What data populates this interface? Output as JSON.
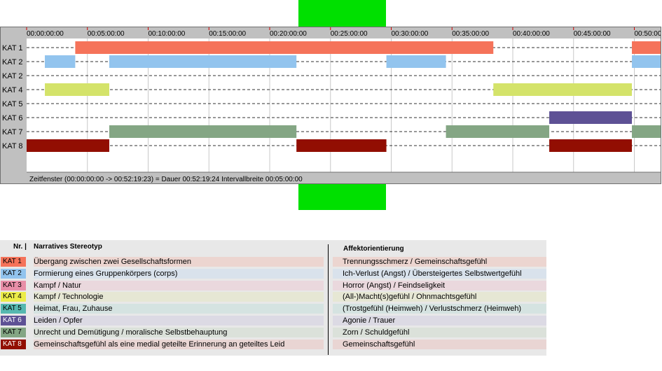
{
  "timeline": {
    "row_labels": [
      "KAT 1",
      "KAT 2",
      "KAT 2",
      "KAT 4",
      "KAT 5",
      "KAT 6",
      "KAT 7",
      "KAT 8"
    ],
    "tick_labels": [
      "00:00:00:00",
      "00:05:00:00",
      "00:10:00:00",
      "00:15:00:00",
      "00:20:00:00",
      "00:25:00:00",
      "00:30:00:00",
      "00:35:00:00",
      "00:40:00:00",
      "00:45:00:00",
      "00:50:00"
    ],
    "status_text": "Zeitfenster (00:00:00:00 -> 00:52:19:23) = Dauer 00:52:19:24    Intervallbreite 00:05:00:00",
    "segments": [
      {
        "row": 0,
        "start_min": 4.0,
        "end_min": 38.4,
        "color": "#f5735a"
      },
      {
        "row": 0,
        "start_min": 49.8,
        "end_min": 52.33,
        "color": "#f5735a"
      },
      {
        "row": 1,
        "start_min": 1.5,
        "end_min": 4.0,
        "color": "#92c4ee"
      },
      {
        "row": 1,
        "start_min": 6.8,
        "end_min": 22.2,
        "color": "#92c4ee"
      },
      {
        "row": 1,
        "start_min": 29.6,
        "end_min": 34.5,
        "color": "#92c4ee"
      },
      {
        "row": 1,
        "start_min": 49.8,
        "end_min": 52.33,
        "color": "#92c4ee"
      },
      {
        "row": 3,
        "start_min": 1.5,
        "end_min": 6.8,
        "color": "#d4e36a"
      },
      {
        "row": 3,
        "start_min": 38.4,
        "end_min": 49.8,
        "color": "#d4e36a"
      },
      {
        "row": 5,
        "start_min": 43.0,
        "end_min": 49.8,
        "color": "#5e5195"
      },
      {
        "row": 6,
        "start_min": 6.8,
        "end_min": 22.2,
        "color": "#84a684"
      },
      {
        "row": 6,
        "start_min": 34.5,
        "end_min": 43.0,
        "color": "#84a684"
      },
      {
        "row": 6,
        "start_min": 49.8,
        "end_min": 52.33,
        "color": "#84a684"
      },
      {
        "row": 7,
        "start_min": 0,
        "end_min": 6.8,
        "color": "#920e02"
      },
      {
        "row": 7,
        "start_min": 22.2,
        "end_min": 29.6,
        "color": "#920e02"
      },
      {
        "row": 7,
        "start_min": 43.0,
        "end_min": 49.8,
        "color": "#920e02"
      }
    ]
  },
  "legend": {
    "header_nr": "Nr. |",
    "header_stereotyp": "Narratives Stereotyp",
    "header_affekt": "Affektorientierung",
    "rows": [
      {
        "kat": "KAT 1",
        "badge_color": "#f5735a",
        "row_color": "#ecd5d0",
        "stereotyp": "Übergang zwischen zwei Gesellschaftsformen",
        "affekt": "Trennungsschmerz / Gemeinschaftsgefühl"
      },
      {
        "kat": "KAT 2",
        "badge_color": "#92c4ee",
        "row_color": "#d9e2ec",
        "stereotyp": "Formierung eines Gruppenkörpers (corps)",
        "affekt": "Ich-Verlust (Angst) / Übersteigertes Selbstwertgefühl"
      },
      {
        "kat": "KAT 3",
        "badge_color": "#e88fa8",
        "row_color": "#ead8dd",
        "stereotyp": "Kampf / Natur",
        "affekt": "Horror (Angst) / Feindseligkeit"
      },
      {
        "kat": "KAT 4",
        "badge_color": "#ecec48",
        "row_color": "#e6e7d4",
        "stereotyp": "Kampf / Technologie",
        "affekt": "(All-)Macht(s)gefühl / Ohnmachtsgefühl"
      },
      {
        "kat": "KAT 5",
        "badge_color": "#56b8b0",
        "row_color": "#d5e3e1",
        "stereotyp": "Heimat, Frau, Zuhause",
        "affekt": "(Trostgefühl (Heimweh) / Verlustschmerz (Heimweh)"
      },
      {
        "kat": "KAT 6",
        "badge_color": "#5e5195",
        "row_color": "#dcdae4",
        "stereotyp": "Leiden / Opfer",
        "affekt": "Agonie / Trauer"
      },
      {
        "kat": "KAT 7",
        "badge_color": "#84a684",
        "row_color": "#dbe1da",
        "stereotyp": "Unrecht und Demütigung / moralische Selbstbehauptung",
        "affekt": "Zorn / Schuldgefühl"
      },
      {
        "kat": "KAT 8",
        "badge_color": "#920e02",
        "row_color": "#e9d5d3",
        "stereotyp": "Gemeinschaftsgefühl als eine medial geteilte Erinnerung an geteiltes Leid",
        "affekt": "Gemeinschaftsgefühl"
      }
    ]
  }
}
